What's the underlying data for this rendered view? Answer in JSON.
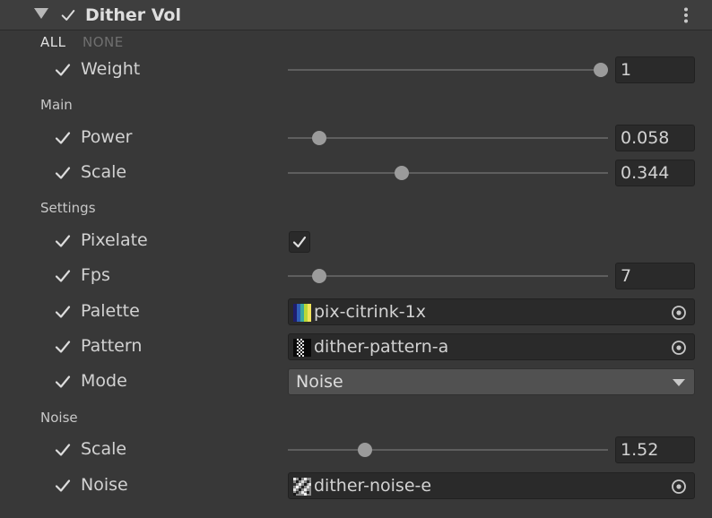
{
  "header": {
    "title": "Dither Vol",
    "enabled": true
  },
  "toggle_all": {
    "all_label": "ALL",
    "none_label": "NONE"
  },
  "weight": {
    "label": "Weight",
    "value": "1",
    "slider_fraction": 1.0
  },
  "main": {
    "header": "Main",
    "power": {
      "label": "Power",
      "value": "0.058",
      "slider_fraction": 0.08
    },
    "scale": {
      "label": "Scale",
      "value": "0.344",
      "slider_fraction": 0.35
    }
  },
  "settings": {
    "header": "Settings",
    "pixelate": {
      "label": "Pixelate",
      "checked": true
    },
    "fps": {
      "label": "Fps",
      "value": "7",
      "slider_fraction": 0.08
    },
    "palette": {
      "label": "Palette",
      "asset": "pix-citrink-1x"
    },
    "pattern": {
      "label": "Pattern",
      "asset": "dither-pattern-a"
    },
    "mode": {
      "label": "Mode",
      "selected": "Noise"
    }
  },
  "noise": {
    "header": "Noise",
    "scale": {
      "label": "Scale",
      "value": "1.52",
      "slider_fraction": 0.23
    },
    "noise": {
      "label": "Noise",
      "asset": "dither-noise-e"
    }
  },
  "colors": {
    "panel_bg": "#383838",
    "header_bg": "#3e3e3e",
    "field_bg": "#2a2a2a",
    "dropdown_bg": "#515151",
    "text": "#d2d2d2",
    "muted_text": "#6f6f6f",
    "slider_track": "#5e5e5e",
    "slider_thumb": "#9b9b9b"
  },
  "icons": {
    "foldout": "triangle-down",
    "enable_toggle": "checkmark",
    "context_menu": "vertical-ellipsis",
    "object_picker": "target-circle",
    "dropdown": "triangle-down"
  }
}
